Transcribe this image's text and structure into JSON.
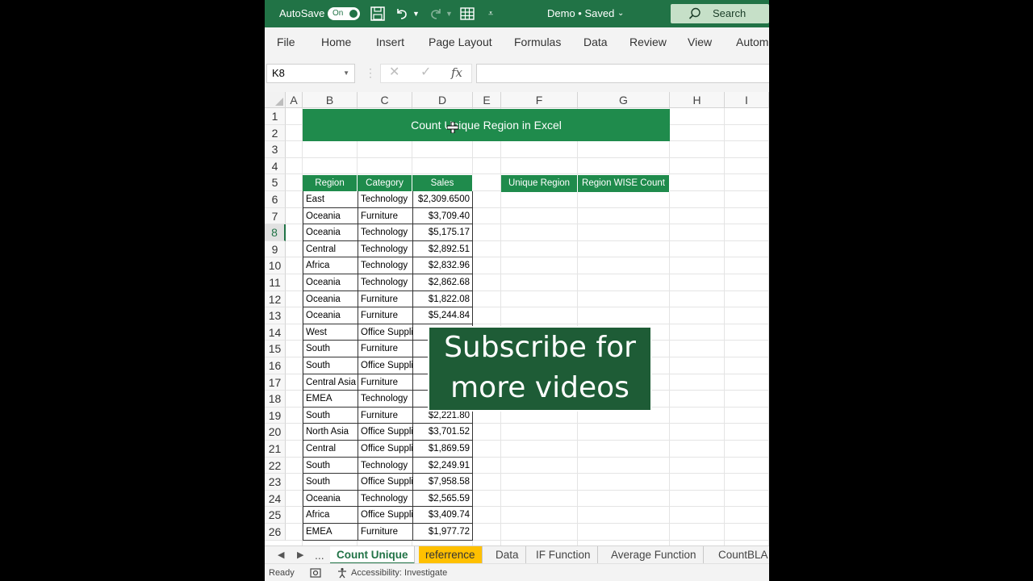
{
  "titlebar": {
    "autosave_label": "AutoSave",
    "toggle_label": "On",
    "doc_title": "Demo • Saved",
    "search_placeholder": "Search"
  },
  "ribbon": {
    "tabs": [
      "File",
      "Home",
      "Insert",
      "Page Layout",
      "Formulas",
      "Data",
      "Review",
      "View",
      "Autom"
    ]
  },
  "formula_bar": {
    "name_box": "K8",
    "formula": ""
  },
  "grid": {
    "columns": [
      "A",
      "B",
      "C",
      "D",
      "E",
      "F",
      "G",
      "H",
      "I"
    ],
    "rows": [
      "1",
      "2",
      "3",
      "4",
      "5",
      "6",
      "7",
      "8",
      "9",
      "10",
      "11",
      "12",
      "13",
      "14",
      "15",
      "16",
      "17",
      "18",
      "19",
      "20",
      "21",
      "22",
      "23",
      "24",
      "25",
      "26"
    ],
    "selected_row": "8",
    "banner_title": "Count Unique Region in Excel",
    "table_headers": [
      "Region",
      "Category",
      "Sales"
    ],
    "side_headers": [
      "Unique Region",
      "Region WISE Count"
    ],
    "table_rows": [
      [
        "East",
        "Technology",
        "$2,309.6500"
      ],
      [
        "Oceania",
        "Furniture",
        "$3,709.40"
      ],
      [
        "Oceania",
        "Technology",
        "$5,175.17"
      ],
      [
        "Central",
        "Technology",
        "$2,892.51"
      ],
      [
        "Africa",
        "Technology",
        "$2,832.96"
      ],
      [
        "Oceania",
        "Technology",
        "$2,862.68"
      ],
      [
        "Oceania",
        "Furniture",
        "$1,822.08"
      ],
      [
        "Oceania",
        "Furniture",
        "$5,244.84"
      ],
      [
        "West",
        "Office Supplies",
        ""
      ],
      [
        "South",
        "Furniture",
        ""
      ],
      [
        "South",
        "Office Supplies",
        ""
      ],
      [
        "Central Asia",
        "Furniture",
        ""
      ],
      [
        "EMEA",
        "Technology",
        ""
      ],
      [
        "South",
        "Furniture",
        "$2,221.80"
      ],
      [
        "North Asia",
        "Office Supplies",
        "$3,701.52"
      ],
      [
        "Central",
        "Office Supplies",
        "$1,869.59"
      ],
      [
        "South",
        "Technology",
        "$2,249.91"
      ],
      [
        "South",
        "Office Supplies",
        "$7,958.58"
      ],
      [
        "Oceania",
        "Technology",
        "$2,565.59"
      ],
      [
        "Africa",
        "Office Supplies",
        "$3,409.74"
      ],
      [
        "EMEA",
        "Furniture",
        "$1,977.72"
      ]
    ]
  },
  "promo": {
    "line1": "Subscribe for",
    "line2": "more videos"
  },
  "sheet_tabs": {
    "ellipsis": "...",
    "tabs": [
      "Count Unique",
      "referrence",
      "Data",
      "IF Function",
      "Average Function",
      "CountBLA"
    ]
  },
  "status_bar": {
    "ready": "Ready",
    "accessibility": "Accessibility: Investigate"
  },
  "colors": {
    "excel_green": "#217346",
    "header_green": "#1f8b4c",
    "promo_bg": "#1e5c36",
    "tab_yellow": "#ffc000"
  }
}
